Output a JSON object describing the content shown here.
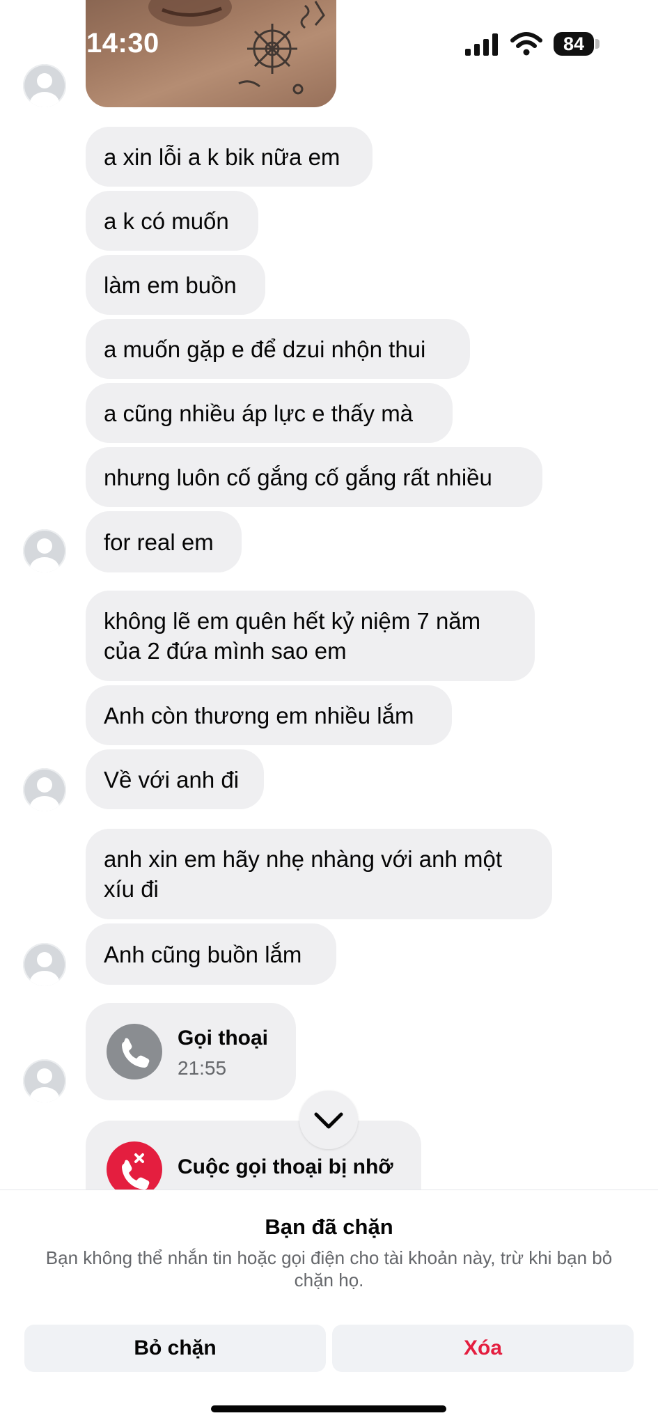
{
  "status_bar": {
    "time": "14:30",
    "battery": "84"
  },
  "messages": [
    "a xin lỗi a k bik nữa em",
    "a k có muốn",
    "làm em buồn",
    "a muốn gặp e để dzui nhộn thui",
    "a cũng nhiều áp lực e thấy mà",
    "nhưng luôn cố gắng cố gắng rất nhiều",
    "for real em",
    "không lẽ em quên hết kỷ niệm 7 năm\ncủa 2 đứa mình sao em",
    "Anh còn thương em nhiều lắm",
    "Về với anh đi",
    "anh xin em hãy nhẹ nhàng với anh một\nxíu đi",
    "Anh cũng buồn lắm"
  ],
  "voice_call": {
    "title": "Gọi thoại",
    "time": "21:55",
    "icon": "phone-icon"
  },
  "missed_call": {
    "title": "Cuộc gọi thoại bị nhỡ",
    "icon": "missed-call-icon",
    "color": "#e41e3f"
  },
  "blocked_notice": {
    "title": "Bạn đã chặn",
    "description": "Bạn không thể nhắn tin hoặc gọi điện cho tài khoản này, trừ khi bạn bỏ chặn họ."
  },
  "actions": {
    "unblock_label": "Bỏ chặn",
    "delete_label": "Xóa",
    "delete_color": "#e41e3f"
  }
}
